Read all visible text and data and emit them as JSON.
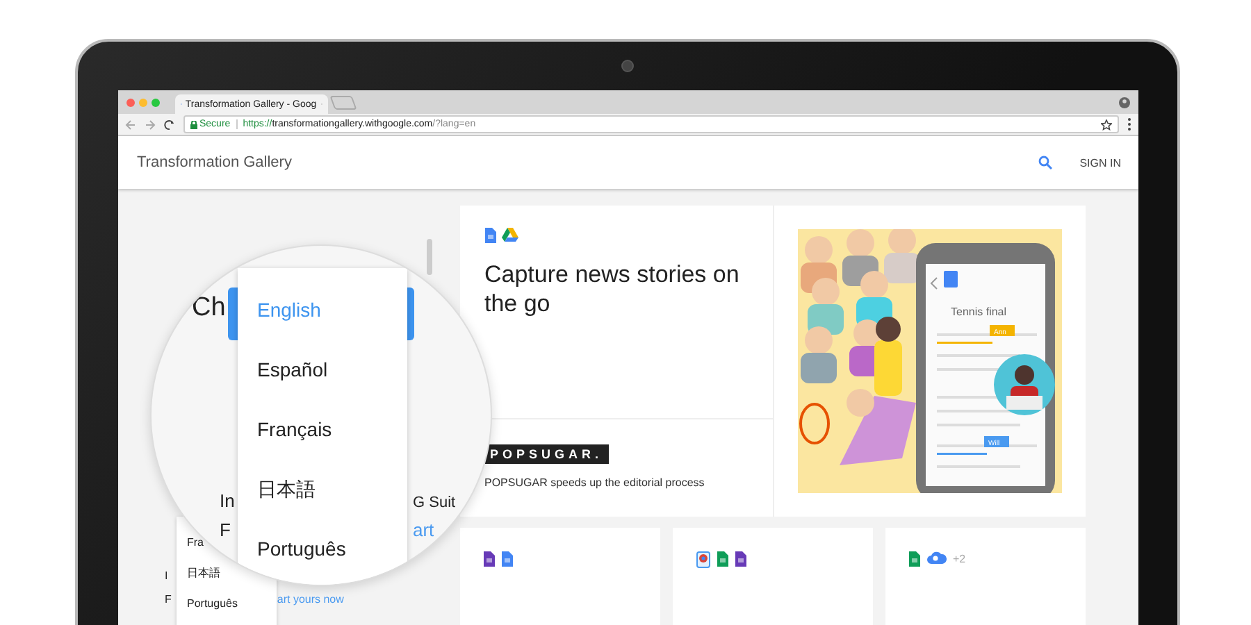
{
  "browser": {
    "tab_title": "Transformation Gallery - Goog",
    "secure_label": "Secure",
    "url_scheme": "https://",
    "url_host": "transformationgallery.withgoogle.com",
    "url_path": "/?lang=en"
  },
  "header": {
    "title": "Transformation Gallery",
    "sign_in": "SIGN IN"
  },
  "left_panel": {
    "dropdown_items": [
      "Fra",
      "日本語",
      "Português"
    ],
    "rows": [
      [
        {
          "text": "I",
          "kind": "plain"
        }
      ],
      [
        {
          "text": "F",
          "kind": "plain"
        },
        {
          "text": "art yours now",
          "kind": "link"
        }
      ]
    ]
  },
  "magnifier": {
    "heading": "Ch",
    "languages": [
      {
        "label": "English",
        "selected": true
      },
      {
        "label": "Español",
        "selected": false
      },
      {
        "label": "Français",
        "selected": false
      },
      {
        "label": "日本語",
        "selected": false
      },
      {
        "label": "Português",
        "selected": false
      }
    ],
    "rows": [
      [
        {
          "text": "In",
          "kind": "plain"
        },
        {
          "text": "G Suit",
          "kind": "plain"
        }
      ],
      [
        {
          "text": "F",
          "kind": "plain"
        },
        {
          "text": "art",
          "kind": "link"
        }
      ]
    ]
  },
  "featured": {
    "app_icons": [
      {
        "kind": "docs"
      },
      {
        "kind": "drive"
      }
    ],
    "headline": "Capture news stories on the go",
    "logo": "POPSUGAR.",
    "caption": "POPSUGAR speeds up the editorial process",
    "illustration": {
      "doc_title": "Tennis final",
      "comments": [
        {
          "name": "Ann",
          "color": "#f4b400"
        },
        {
          "name": "Will",
          "color": "#4a9af0"
        }
      ]
    }
  },
  "cards": [
    {
      "app_icons": [
        {
          "kind": "slides"
        },
        {
          "kind": "docs"
        }
      ]
    },
    {
      "app_icons": [
        {
          "kind": "chrome"
        },
        {
          "kind": "sheets"
        },
        {
          "kind": "slides"
        }
      ]
    },
    {
      "app_icons": [
        {
          "kind": "sheets"
        },
        {
          "kind": "cloud"
        }
      ],
      "more": "+2"
    }
  ]
}
